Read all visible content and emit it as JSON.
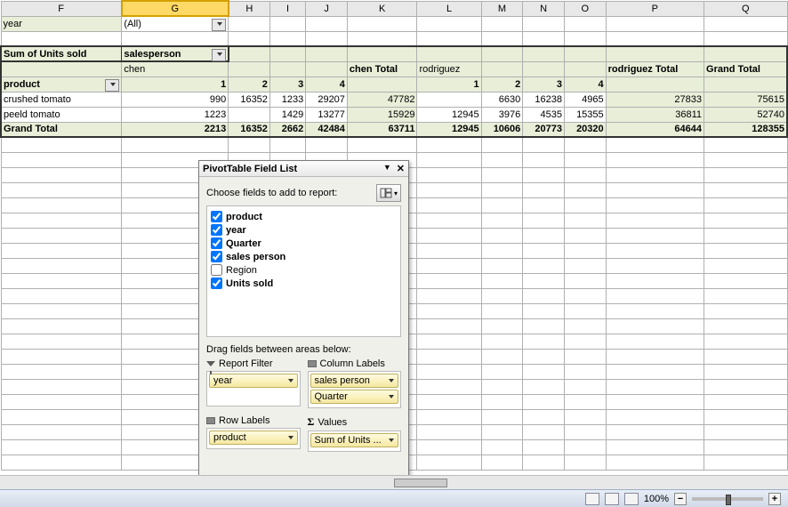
{
  "columns": [
    "F",
    "G",
    "H",
    "I",
    "J",
    "K",
    "L",
    "M",
    "N",
    "O",
    "P",
    "Q"
  ],
  "selected_column": "G",
  "filter_row": {
    "label": "year",
    "value": "(All)"
  },
  "headers_row1": {
    "sum_label": "Sum of Units sold",
    "salesperson_label": "salesperson"
  },
  "headers_row2": {
    "chen": "chen",
    "chen_total": "chen Total",
    "rodriguez": "rodriguez",
    "rodriguez_total": "rodriguez Total",
    "grand_total": "Grand Total"
  },
  "product_label": "product",
  "quarter_nums_chen": [
    "1",
    "2",
    "3",
    "4"
  ],
  "quarter_nums_rod": [
    "1",
    "2",
    "3",
    "4"
  ],
  "rows": [
    {
      "label": "crushed tomato",
      "chen": [
        "990",
        "16352",
        "1233",
        "29207"
      ],
      "chen_total": "47782",
      "rod": [
        "",
        "6630",
        "16238",
        "4965"
      ],
      "rod_total": "27833",
      "grand": "75615"
    },
    {
      "label": "peeld tomato",
      "chen": [
        "1223",
        "",
        "1429",
        "13277"
      ],
      "chen_total": "15929",
      "rod": [
        "12945",
        "3976",
        "4535",
        "15355"
      ],
      "rod_total": "36811",
      "grand": "52740"
    }
  ],
  "grand_row": {
    "label": "Grand Total",
    "chen": [
      "2213",
      "16352",
      "2662",
      "42484"
    ],
    "chen_total": "63711",
    "rod": [
      "12945",
      "10606",
      "20773",
      "20320"
    ],
    "rod_total": "64644",
    "grand": "128355"
  },
  "panel": {
    "title": "PivotTable Field List",
    "choose": "Choose fields to add to report:",
    "fields": [
      {
        "name": "product",
        "checked": true,
        "bold": true
      },
      {
        "name": "year",
        "checked": true,
        "bold": true
      },
      {
        "name": "Quarter",
        "checked": true,
        "bold": true
      },
      {
        "name": "sales person",
        "checked": true,
        "bold": true
      },
      {
        "name": "Region",
        "checked": false,
        "bold": false
      },
      {
        "name": "Units sold",
        "checked": true,
        "bold": true
      }
    ],
    "drag_label": "Drag fields between areas below:",
    "report_filter": "Report Filter",
    "column_labels": "Column Labels",
    "row_labels": "Row Labels",
    "values_label": "Values",
    "rf_chip": "year",
    "cl_chips": [
      "sales person",
      "Quarter"
    ],
    "rl_chip": "product",
    "val_chip": "Sum of Units ..."
  },
  "statusbar": {
    "zoom": "100%"
  },
  "chart_data": {
    "type": "table",
    "pivot": {
      "filter": {
        "field": "year",
        "value": "(All)"
      },
      "columns": [
        "salesperson",
        "Quarter"
      ],
      "rows": [
        "product"
      ],
      "values": "Sum of Units sold",
      "data": {
        "crushed tomato": {
          "chen": {
            "1": 990,
            "2": 16352,
            "3": 1233,
            "4": 29207,
            "total": 47782
          },
          "rodriguez": {
            "1": null,
            "2": 6630,
            "3": 16238,
            "4": 4965,
            "total": 27833
          },
          "grand": 75615
        },
        "peeld tomato": {
          "chen": {
            "1": 1223,
            "2": null,
            "3": 1429,
            "4": 13277,
            "total": 15929
          },
          "rodriguez": {
            "1": 12945,
            "2": 3976,
            "3": 4535,
            "4": 15355,
            "total": 36811
          },
          "grand": 52740
        },
        "Grand Total": {
          "chen": {
            "1": 2213,
            "2": 16352,
            "3": 2662,
            "4": 42484,
            "total": 63711
          },
          "rodriguez": {
            "1": 12945,
            "2": 10606,
            "3": 20773,
            "4": 20320,
            "total": 64644
          },
          "grand": 128355
        }
      }
    }
  }
}
